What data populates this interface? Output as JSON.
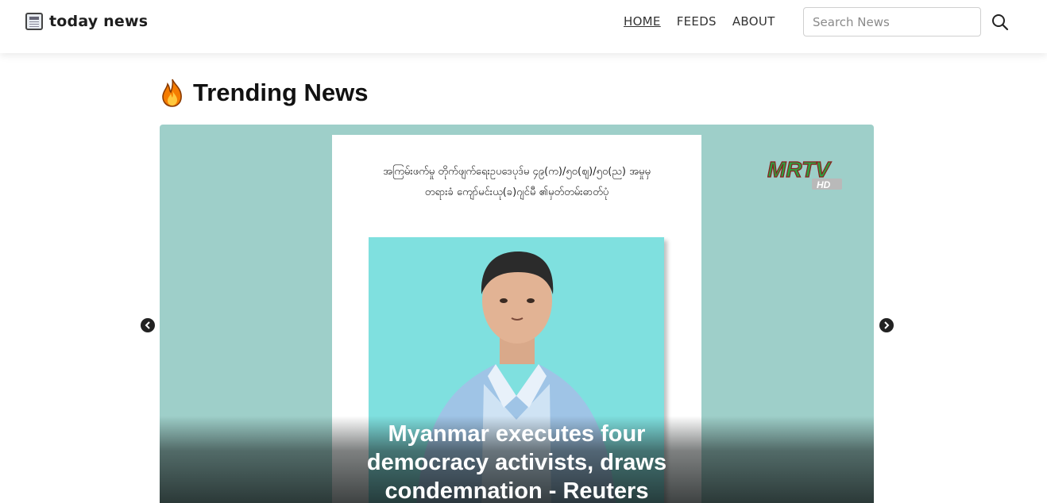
{
  "brand": {
    "name": "today news",
    "icon": "newspaper-icon"
  },
  "nav": {
    "items": [
      {
        "label": "HOME",
        "active": true
      },
      {
        "label": "FEEDS",
        "active": false
      },
      {
        "label": "ABOUT",
        "active": false
      }
    ]
  },
  "search": {
    "placeholder": "Search News",
    "value": "",
    "icon": "search-icon"
  },
  "section": {
    "title": "Trending News",
    "icon": "fire-icon"
  },
  "slide": {
    "image_text_line1": "အကြမ်းဖက်မှု တိုက်ဖျက်ရေးဥပဒေပုဒ်မ ၄၉(က)/၅၀(ဈ)/၅၀(ည) အမှုမှ",
    "image_text_line2": "တရားခံ ကျော်မင်းယု(ခ)ဂျင်မီ ၏မှတ်တမ်းဓာတ်ပုံ",
    "logo_text": "MRTV",
    "logo_badge": "HD",
    "caption": "Myanmar executes four democracy activists, draws condemnation - Reuters"
  },
  "controls": {
    "prev_icon": "chevron-left-icon",
    "next_icon": "chevron-right-icon"
  },
  "colors": {
    "slide_bg": "#9ecfc9",
    "photo_bg": "#7fe0df",
    "logo_red": "#d32b2b",
    "logo_green": "#3aa43a",
    "logo_yellow": "#f1c232"
  }
}
